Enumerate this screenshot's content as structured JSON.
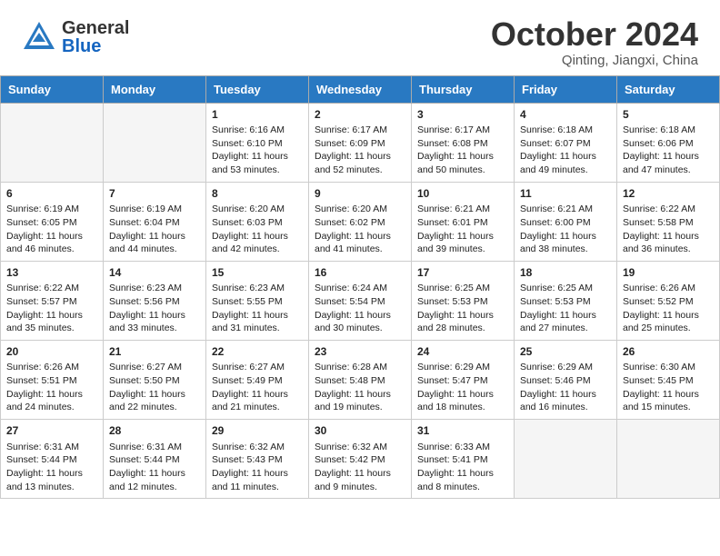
{
  "header": {
    "logo_general": "General",
    "logo_blue": "Blue",
    "month_year": "October 2024",
    "location": "Qinting, Jiangxi, China"
  },
  "calendar": {
    "days_of_week": [
      "Sunday",
      "Monday",
      "Tuesday",
      "Wednesday",
      "Thursday",
      "Friday",
      "Saturday"
    ],
    "weeks": [
      [
        {
          "day": "",
          "info": ""
        },
        {
          "day": "",
          "info": ""
        },
        {
          "day": "1",
          "info": "Sunrise: 6:16 AM\nSunset: 6:10 PM\nDaylight: 11 hours and 53 minutes."
        },
        {
          "day": "2",
          "info": "Sunrise: 6:17 AM\nSunset: 6:09 PM\nDaylight: 11 hours and 52 minutes."
        },
        {
          "day": "3",
          "info": "Sunrise: 6:17 AM\nSunset: 6:08 PM\nDaylight: 11 hours and 50 minutes."
        },
        {
          "day": "4",
          "info": "Sunrise: 6:18 AM\nSunset: 6:07 PM\nDaylight: 11 hours and 49 minutes."
        },
        {
          "day": "5",
          "info": "Sunrise: 6:18 AM\nSunset: 6:06 PM\nDaylight: 11 hours and 47 minutes."
        }
      ],
      [
        {
          "day": "6",
          "info": "Sunrise: 6:19 AM\nSunset: 6:05 PM\nDaylight: 11 hours and 46 minutes."
        },
        {
          "day": "7",
          "info": "Sunrise: 6:19 AM\nSunset: 6:04 PM\nDaylight: 11 hours and 44 minutes."
        },
        {
          "day": "8",
          "info": "Sunrise: 6:20 AM\nSunset: 6:03 PM\nDaylight: 11 hours and 42 minutes."
        },
        {
          "day": "9",
          "info": "Sunrise: 6:20 AM\nSunset: 6:02 PM\nDaylight: 11 hours and 41 minutes."
        },
        {
          "day": "10",
          "info": "Sunrise: 6:21 AM\nSunset: 6:01 PM\nDaylight: 11 hours and 39 minutes."
        },
        {
          "day": "11",
          "info": "Sunrise: 6:21 AM\nSunset: 6:00 PM\nDaylight: 11 hours and 38 minutes."
        },
        {
          "day": "12",
          "info": "Sunrise: 6:22 AM\nSunset: 5:58 PM\nDaylight: 11 hours and 36 minutes."
        }
      ],
      [
        {
          "day": "13",
          "info": "Sunrise: 6:22 AM\nSunset: 5:57 PM\nDaylight: 11 hours and 35 minutes."
        },
        {
          "day": "14",
          "info": "Sunrise: 6:23 AM\nSunset: 5:56 PM\nDaylight: 11 hours and 33 minutes."
        },
        {
          "day": "15",
          "info": "Sunrise: 6:23 AM\nSunset: 5:55 PM\nDaylight: 11 hours and 31 minutes."
        },
        {
          "day": "16",
          "info": "Sunrise: 6:24 AM\nSunset: 5:54 PM\nDaylight: 11 hours and 30 minutes."
        },
        {
          "day": "17",
          "info": "Sunrise: 6:25 AM\nSunset: 5:53 PM\nDaylight: 11 hours and 28 minutes."
        },
        {
          "day": "18",
          "info": "Sunrise: 6:25 AM\nSunset: 5:53 PM\nDaylight: 11 hours and 27 minutes."
        },
        {
          "day": "19",
          "info": "Sunrise: 6:26 AM\nSunset: 5:52 PM\nDaylight: 11 hours and 25 minutes."
        }
      ],
      [
        {
          "day": "20",
          "info": "Sunrise: 6:26 AM\nSunset: 5:51 PM\nDaylight: 11 hours and 24 minutes."
        },
        {
          "day": "21",
          "info": "Sunrise: 6:27 AM\nSunset: 5:50 PM\nDaylight: 11 hours and 22 minutes."
        },
        {
          "day": "22",
          "info": "Sunrise: 6:27 AM\nSunset: 5:49 PM\nDaylight: 11 hours and 21 minutes."
        },
        {
          "day": "23",
          "info": "Sunrise: 6:28 AM\nSunset: 5:48 PM\nDaylight: 11 hours and 19 minutes."
        },
        {
          "day": "24",
          "info": "Sunrise: 6:29 AM\nSunset: 5:47 PM\nDaylight: 11 hours and 18 minutes."
        },
        {
          "day": "25",
          "info": "Sunrise: 6:29 AM\nSunset: 5:46 PM\nDaylight: 11 hours and 16 minutes."
        },
        {
          "day": "26",
          "info": "Sunrise: 6:30 AM\nSunset: 5:45 PM\nDaylight: 11 hours and 15 minutes."
        }
      ],
      [
        {
          "day": "27",
          "info": "Sunrise: 6:31 AM\nSunset: 5:44 PM\nDaylight: 11 hours and 13 minutes."
        },
        {
          "day": "28",
          "info": "Sunrise: 6:31 AM\nSunset: 5:44 PM\nDaylight: 11 hours and 12 minutes."
        },
        {
          "day": "29",
          "info": "Sunrise: 6:32 AM\nSunset: 5:43 PM\nDaylight: 11 hours and 11 minutes."
        },
        {
          "day": "30",
          "info": "Sunrise: 6:32 AM\nSunset: 5:42 PM\nDaylight: 11 hours and 9 minutes."
        },
        {
          "day": "31",
          "info": "Sunrise: 6:33 AM\nSunset: 5:41 PM\nDaylight: 11 hours and 8 minutes."
        },
        {
          "day": "",
          "info": ""
        },
        {
          "day": "",
          "info": ""
        }
      ]
    ]
  }
}
